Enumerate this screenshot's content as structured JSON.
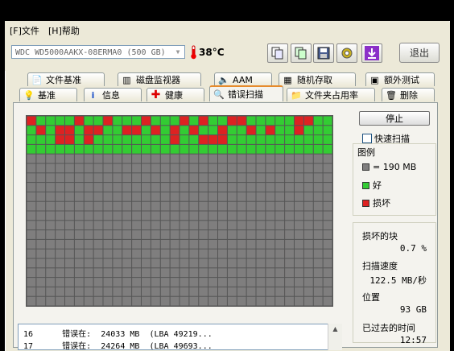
{
  "menu": {
    "file": "文件",
    "file_key": "F",
    "help": "帮助",
    "help_key": "H"
  },
  "toolbar": {
    "drive": "WDC WD5000AAKX-08ERMA0 (500 GB)",
    "temperature": "38°C",
    "exit": "退出",
    "icons": [
      "copy-icon",
      "copy-alt-icon",
      "save-icon",
      "settings-icon",
      "download-icon"
    ]
  },
  "tabs_top": [
    {
      "label": "文件基准",
      "icon": "document-icon"
    },
    {
      "label": "磁盘监视器",
      "icon": "chart-icon"
    },
    {
      "label": "AAM",
      "icon": "speaker-icon"
    },
    {
      "label": "随机存取",
      "icon": "grid-icon"
    },
    {
      "label": "额外测试",
      "icon": "window-icon"
    }
  ],
  "tabs_bottom": [
    {
      "label": "基准",
      "icon": "bulb-icon"
    },
    {
      "label": "信息",
      "icon": "info-icon"
    },
    {
      "label": "健康",
      "icon": "plus-icon"
    },
    {
      "label": "错误扫描",
      "icon": "magnifier-icon",
      "active": true
    },
    {
      "label": "文件夹占用率",
      "icon": "folder-icon"
    },
    {
      "label": "删除",
      "icon": "trash-icon"
    }
  ],
  "scan": {
    "stop": "停止",
    "quick_scan": "快速扫描",
    "legend_title": "图例",
    "legend_block": "= 190 MB",
    "legend_good": "好",
    "legend_bad": "损坏",
    "colors": {
      "good": "#33cc33",
      "bad": "#dd2222",
      "pending": "#7f7e7e"
    },
    "grid": {
      "cols": 32,
      "rows": 20,
      "scanned_rows": 4,
      "bad_blocks": [
        [
          0,
          0
        ],
        [
          0,
          5
        ],
        [
          0,
          8
        ],
        [
          0,
          12
        ],
        [
          0,
          16
        ],
        [
          0,
          18
        ],
        [
          0,
          21
        ],
        [
          0,
          22
        ],
        [
          0,
          28
        ],
        [
          0,
          29
        ],
        [
          1,
          1
        ],
        [
          1,
          3
        ],
        [
          1,
          4
        ],
        [
          1,
          6
        ],
        [
          1,
          7
        ],
        [
          1,
          10
        ],
        [
          1,
          11
        ],
        [
          1,
          13
        ],
        [
          1,
          15
        ],
        [
          1,
          17
        ],
        [
          1,
          20
        ],
        [
          1,
          23
        ],
        [
          1,
          25
        ],
        [
          1,
          28
        ],
        [
          2,
          3
        ],
        [
          2,
          4
        ],
        [
          2,
          6
        ],
        [
          2,
          15
        ],
        [
          2,
          18
        ],
        [
          2,
          19
        ],
        [
          2,
          20
        ]
      ]
    }
  },
  "stats": {
    "bad_blocks_label": "损坏的块",
    "bad_blocks": "0.7 %",
    "speed_label": "扫描速度",
    "speed": "122.5 MB/秒",
    "position_label": "位置",
    "position": "93 GB",
    "elapsed_label": "已过去的时间",
    "elapsed": "12:57"
  },
  "log": [
    {
      "n": "16",
      "msg": "错误在:",
      "pos": "24033 MB",
      "lba": "(LBA 49219..."
    },
    {
      "n": "17",
      "msg": "错误在:",
      "pos": "24264 MB",
      "lba": "(LBA 49693..."
    }
  ]
}
